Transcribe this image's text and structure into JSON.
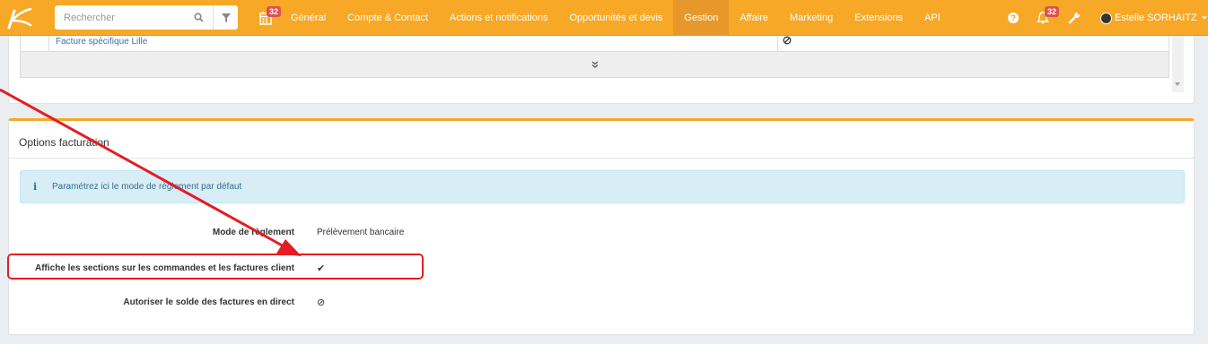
{
  "topbar": {
    "search_placeholder": "Rechercher",
    "calendar_badge": "32",
    "nav": [
      "Général",
      "Compte & Contact",
      "Actions et notifications",
      "Opportunités et devis",
      "Gestion",
      "Affaire",
      "Marketing",
      "Extensions",
      "API"
    ],
    "active_nav": "Gestion",
    "notifications_badge": "32",
    "user_name": "Estelle SORHAITZ"
  },
  "table_remnant": {
    "link_text": "Facture spécifique Lille",
    "expander_symbol": "⌄"
  },
  "billing": {
    "title": "Options facturation",
    "info_text": "Paramétrez ici le mode de règlement par défaut",
    "fields": [
      {
        "label": "Mode de règlement",
        "value": "Prélèvement bancaire"
      },
      {
        "label": "Affiche les sections sur les commandes et les factures client",
        "value": "✔"
      },
      {
        "label": "Autoriser le solde des factures en direct",
        "value": "⊘"
      }
    ]
  },
  "colors": {
    "brand": "#f7a826",
    "active_nav": "#e7982a",
    "annotation": "#e51c23",
    "info_bg": "#d9edf7"
  }
}
